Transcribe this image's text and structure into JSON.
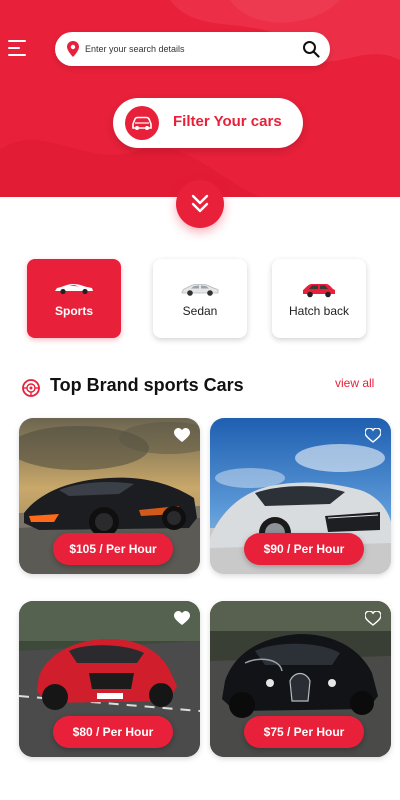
{
  "header": {
    "search": {
      "placeholder": "Enter your search details",
      "value": ""
    },
    "filter_label": "Filter Your cars"
  },
  "categories": [
    {
      "label": "Sports",
      "active": true
    },
    {
      "label": "Sedan",
      "active": false
    },
    {
      "label": "Hatch back",
      "active": false
    }
  ],
  "section": {
    "title": "Top Brand sports Cars",
    "view_all": "view all"
  },
  "cars": [
    {
      "price": "$105 / Per Hour",
      "favorite": false
    },
    {
      "price": "$90 / Per Hour",
      "favorite": false
    },
    {
      "price": "$80 / Per Hour",
      "favorite": false
    },
    {
      "price": "$75 / Per Hour",
      "favorite": false
    }
  ],
  "colors": {
    "accent": "#e8203a",
    "background": "#ffffff"
  },
  "icons": [
    "menu-icon",
    "location-pin-icon",
    "search-icon",
    "car-filter-icon",
    "chevron-double-down-icon",
    "sports-car-icon",
    "sedan-car-icon",
    "hatchback-car-icon",
    "steering-wheel-icon",
    "heart-icon"
  ]
}
